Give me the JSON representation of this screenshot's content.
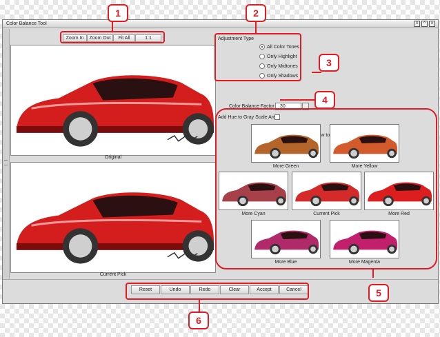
{
  "window": {
    "title": "Color Balance Tool",
    "controls": {
      "menu": "≡",
      "minimize": "^",
      "close": "x"
    }
  },
  "zoom_toolbar": {
    "zoom_in": "Zoom In",
    "zoom_out": "Zoom Out",
    "fit_all": "Fit All",
    "one_to_one": "1:1"
  },
  "panels": {
    "original_caption": "Original",
    "current_pick_caption": "Current Pick"
  },
  "adjustment": {
    "title": "Adjustment Type",
    "options": [
      {
        "label": "All Color Tones",
        "selected": true
      },
      {
        "label": "Only Highlight",
        "selected": false
      },
      {
        "label": "Only Midtones",
        "selected": false
      },
      {
        "label": "Only Shadows",
        "selected": false
      }
    ]
  },
  "factor": {
    "label": "Color Balance Factor",
    "value": "30"
  },
  "hue": {
    "label": "Add Hue to Gray Scale Are",
    "checked": false
  },
  "thumbnails": {
    "instruction": "Click on images below to select adjustment value",
    "items": [
      {
        "label": "More Green",
        "color": "#b4652a"
      },
      {
        "label": "More Yellow",
        "color": "#d35a2a"
      },
      {
        "label": "More Cyan",
        "color": "#a8404a"
      },
      {
        "label": "Current Pick",
        "color": "#d42a2a"
      },
      {
        "label": "More Red",
        "color": "#dc1e1e"
      },
      {
        "label": "More Blue",
        "color": "#b02a6a"
      },
      {
        "label": "More Magenta",
        "color": "#c2206c"
      }
    ]
  },
  "actions": {
    "reset": "Reset",
    "undo": "Undo",
    "redo": "Redo",
    "clear": "Clear",
    "accept": "Accept",
    "cancel": "Cancel"
  },
  "callouts": [
    "1",
    "2",
    "3",
    "4",
    "5",
    "6"
  ],
  "colors": {
    "callout": "#e01b24",
    "car_main": "#d41e1e"
  }
}
